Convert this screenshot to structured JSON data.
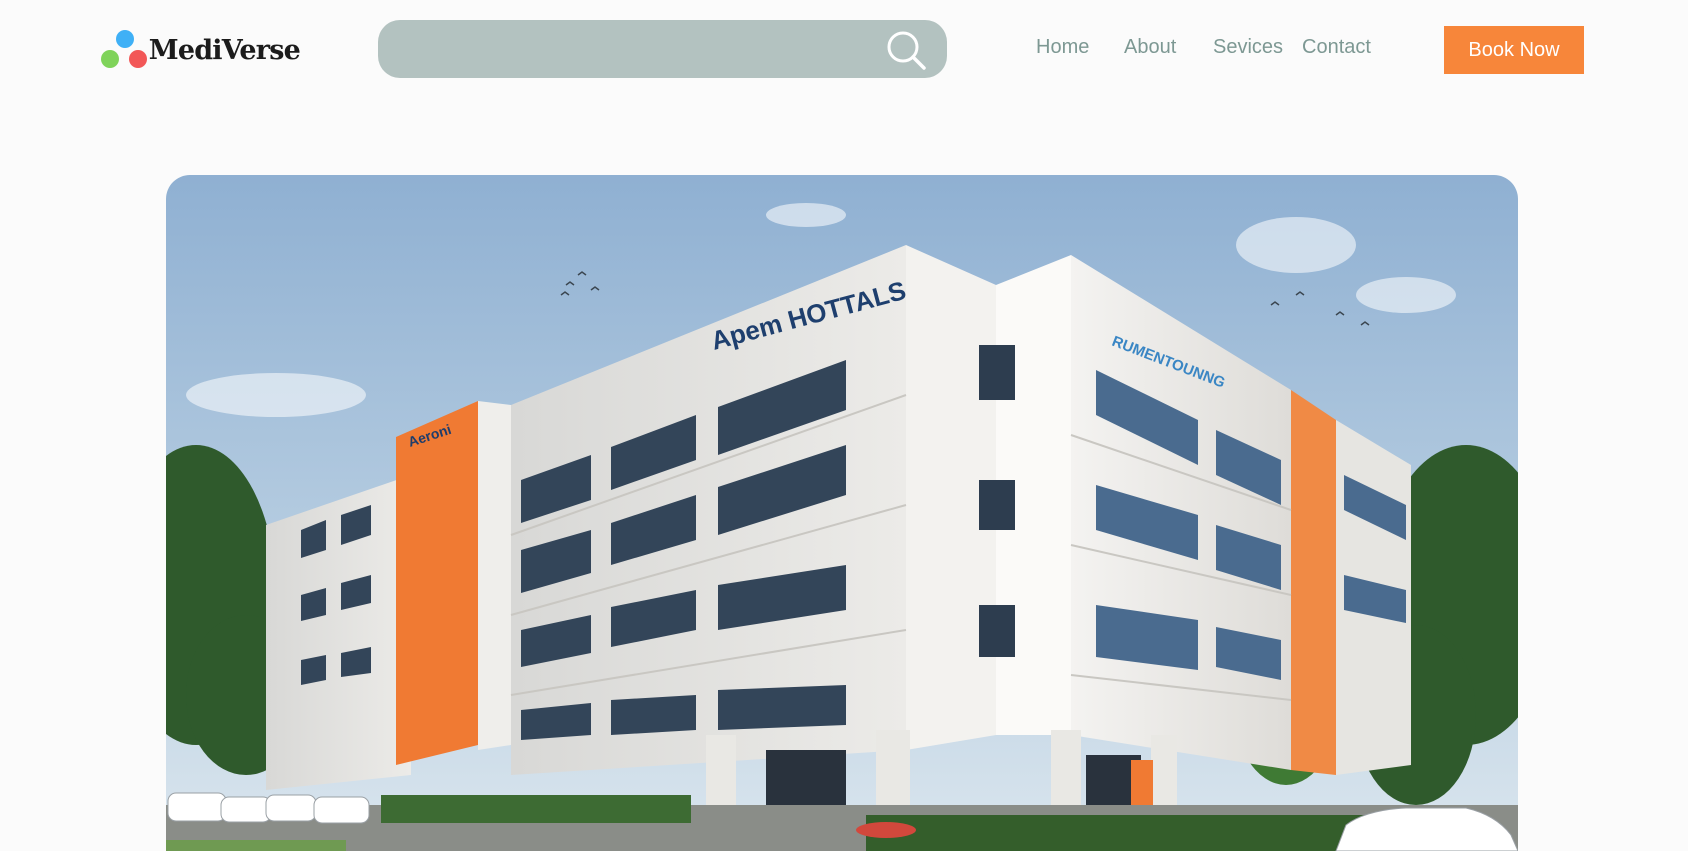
{
  "brand": {
    "name": "MediVerse",
    "icon": "three-dot-logo-icon",
    "dot_colors": [
      "#3fb0f6",
      "#7fd35a",
      "#f25757"
    ]
  },
  "search": {
    "value": "",
    "placeholder": "",
    "icon": "search-icon"
  },
  "nav": {
    "items": [
      "Home",
      "About",
      "Sevices",
      "Contact"
    ]
  },
  "cta": {
    "label": "Book Now",
    "color": "#f7863a"
  },
  "hero": {
    "image": "hospital-building-photo",
    "sign_main": "Apem HOTTALS",
    "sign_side": "RUMENTOUNNG",
    "accent_color": "#f07a33"
  },
  "colors": {
    "search_bg": "#b3c2c0",
    "nav_text": "#7d9893",
    "page_bg": "#fbfbfb"
  }
}
